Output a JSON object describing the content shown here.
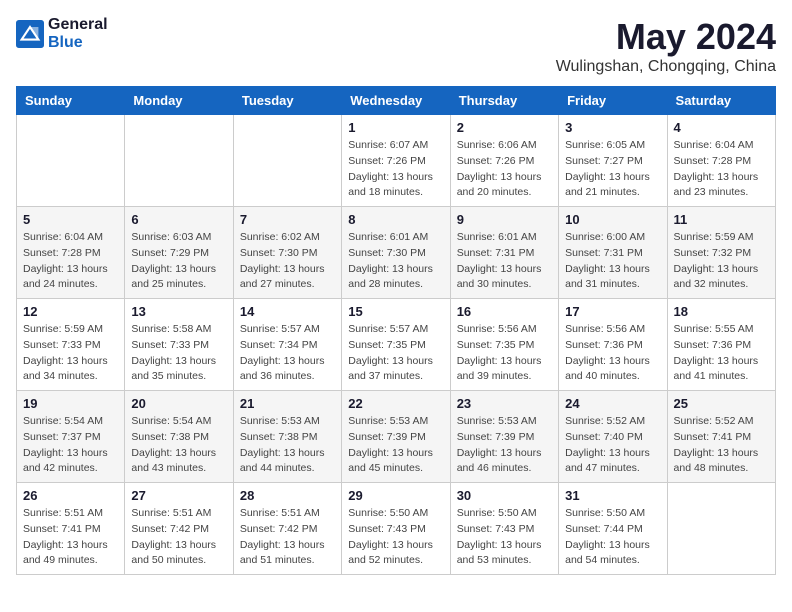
{
  "logo": {
    "text_general": "General",
    "text_blue": "Blue"
  },
  "title": {
    "month_year": "May 2024",
    "location": "Wulingshan, Chongqing, China"
  },
  "headers": [
    "Sunday",
    "Monday",
    "Tuesday",
    "Wednesday",
    "Thursday",
    "Friday",
    "Saturday"
  ],
  "weeks": [
    [
      {
        "day": "",
        "info": ""
      },
      {
        "day": "",
        "info": ""
      },
      {
        "day": "",
        "info": ""
      },
      {
        "day": "1",
        "info": "Sunrise: 6:07 AM\nSunset: 7:26 PM\nDaylight: 13 hours\nand 18 minutes."
      },
      {
        "day": "2",
        "info": "Sunrise: 6:06 AM\nSunset: 7:26 PM\nDaylight: 13 hours\nand 20 minutes."
      },
      {
        "day": "3",
        "info": "Sunrise: 6:05 AM\nSunset: 7:27 PM\nDaylight: 13 hours\nand 21 minutes."
      },
      {
        "day": "4",
        "info": "Sunrise: 6:04 AM\nSunset: 7:28 PM\nDaylight: 13 hours\nand 23 minutes."
      }
    ],
    [
      {
        "day": "5",
        "info": "Sunrise: 6:04 AM\nSunset: 7:28 PM\nDaylight: 13 hours\nand 24 minutes."
      },
      {
        "day": "6",
        "info": "Sunrise: 6:03 AM\nSunset: 7:29 PM\nDaylight: 13 hours\nand 25 minutes."
      },
      {
        "day": "7",
        "info": "Sunrise: 6:02 AM\nSunset: 7:30 PM\nDaylight: 13 hours\nand 27 minutes."
      },
      {
        "day": "8",
        "info": "Sunrise: 6:01 AM\nSunset: 7:30 PM\nDaylight: 13 hours\nand 28 minutes."
      },
      {
        "day": "9",
        "info": "Sunrise: 6:01 AM\nSunset: 7:31 PM\nDaylight: 13 hours\nand 30 minutes."
      },
      {
        "day": "10",
        "info": "Sunrise: 6:00 AM\nSunset: 7:31 PM\nDaylight: 13 hours\nand 31 minutes."
      },
      {
        "day": "11",
        "info": "Sunrise: 5:59 AM\nSunset: 7:32 PM\nDaylight: 13 hours\nand 32 minutes."
      }
    ],
    [
      {
        "day": "12",
        "info": "Sunrise: 5:59 AM\nSunset: 7:33 PM\nDaylight: 13 hours\nand 34 minutes."
      },
      {
        "day": "13",
        "info": "Sunrise: 5:58 AM\nSunset: 7:33 PM\nDaylight: 13 hours\nand 35 minutes."
      },
      {
        "day": "14",
        "info": "Sunrise: 5:57 AM\nSunset: 7:34 PM\nDaylight: 13 hours\nand 36 minutes."
      },
      {
        "day": "15",
        "info": "Sunrise: 5:57 AM\nSunset: 7:35 PM\nDaylight: 13 hours\nand 37 minutes."
      },
      {
        "day": "16",
        "info": "Sunrise: 5:56 AM\nSunset: 7:35 PM\nDaylight: 13 hours\nand 39 minutes."
      },
      {
        "day": "17",
        "info": "Sunrise: 5:56 AM\nSunset: 7:36 PM\nDaylight: 13 hours\nand 40 minutes."
      },
      {
        "day": "18",
        "info": "Sunrise: 5:55 AM\nSunset: 7:36 PM\nDaylight: 13 hours\nand 41 minutes."
      }
    ],
    [
      {
        "day": "19",
        "info": "Sunrise: 5:54 AM\nSunset: 7:37 PM\nDaylight: 13 hours\nand 42 minutes."
      },
      {
        "day": "20",
        "info": "Sunrise: 5:54 AM\nSunset: 7:38 PM\nDaylight: 13 hours\nand 43 minutes."
      },
      {
        "day": "21",
        "info": "Sunrise: 5:53 AM\nSunset: 7:38 PM\nDaylight: 13 hours\nand 44 minutes."
      },
      {
        "day": "22",
        "info": "Sunrise: 5:53 AM\nSunset: 7:39 PM\nDaylight: 13 hours\nand 45 minutes."
      },
      {
        "day": "23",
        "info": "Sunrise: 5:53 AM\nSunset: 7:39 PM\nDaylight: 13 hours\nand 46 minutes."
      },
      {
        "day": "24",
        "info": "Sunrise: 5:52 AM\nSunset: 7:40 PM\nDaylight: 13 hours\nand 47 minutes."
      },
      {
        "day": "25",
        "info": "Sunrise: 5:52 AM\nSunset: 7:41 PM\nDaylight: 13 hours\nand 48 minutes."
      }
    ],
    [
      {
        "day": "26",
        "info": "Sunrise: 5:51 AM\nSunset: 7:41 PM\nDaylight: 13 hours\nand 49 minutes."
      },
      {
        "day": "27",
        "info": "Sunrise: 5:51 AM\nSunset: 7:42 PM\nDaylight: 13 hours\nand 50 minutes."
      },
      {
        "day": "28",
        "info": "Sunrise: 5:51 AM\nSunset: 7:42 PM\nDaylight: 13 hours\nand 51 minutes."
      },
      {
        "day": "29",
        "info": "Sunrise: 5:50 AM\nSunset: 7:43 PM\nDaylight: 13 hours\nand 52 minutes."
      },
      {
        "day": "30",
        "info": "Sunrise: 5:50 AM\nSunset: 7:43 PM\nDaylight: 13 hours\nand 53 minutes."
      },
      {
        "day": "31",
        "info": "Sunrise: 5:50 AM\nSunset: 7:44 PM\nDaylight: 13 hours\nand 54 minutes."
      },
      {
        "day": "",
        "info": ""
      }
    ]
  ]
}
